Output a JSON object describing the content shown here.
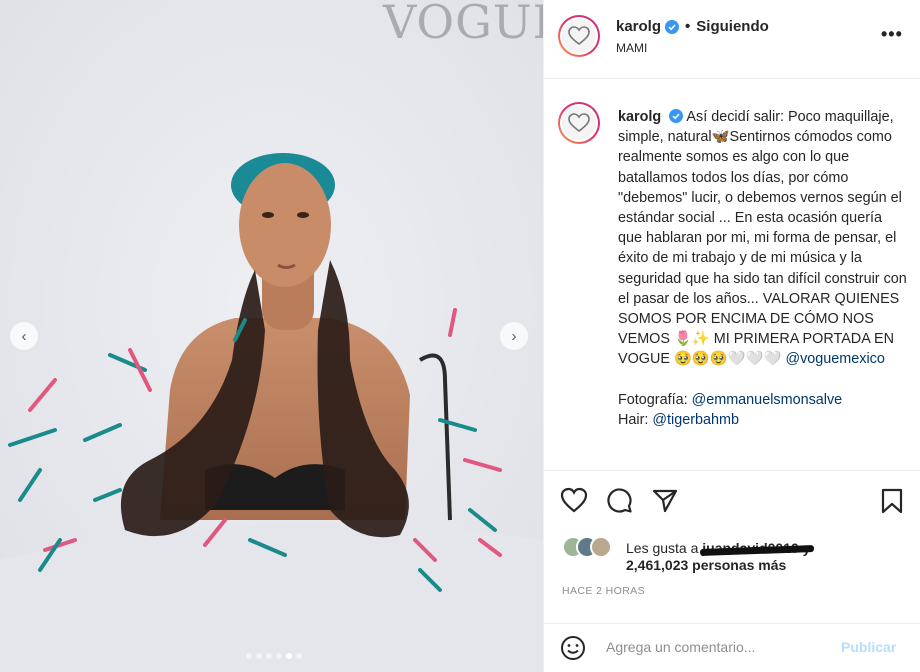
{
  "media": {
    "brand_text": "VOGUE",
    "carousel_dots": 6,
    "carousel_active_index": 4,
    "prev_glyph": "‹",
    "next_glyph": "›"
  },
  "header": {
    "username": "karolg",
    "separator": "•",
    "follow_status": "Siguiendo",
    "location": "MAMI",
    "more_glyph": "•••"
  },
  "caption": {
    "username": "karolg",
    "text_part1": "Así decidí salir: Poco maquillaje, simple, natural🦋Sentirnos cómodos como realmente somos es algo con lo que batallamos todos los días, por cómo \"debemos\" lucir, o debemos vernos según el estándar social ... En esta ocasión quería que hablaran por mi, mi forma de pensar, el éxito de mi trabajo y de mi música y la seguridad que ha sido tan difícil construir con el pasar de los años... VALORAR QUIENES SOMOS POR ENCIMA DE CÓMO NOS VEMOS 🌷✨ MI PRIMERA PORTADA EN VOGUE 🥹🥹🥹🤍🤍🤍",
    "mention_vogue": "@voguemexico",
    "credit_photo_label": "Fotografía: ",
    "credit_photo_mention": "@emmanuelsmonsalve",
    "credit_hair_label": "Hair: ",
    "credit_hair_mention": "@tigerbahmb"
  },
  "actions": {
    "liked_by_prefix": "Les gusta a ",
    "liked_by_user_redacted": "juandavid0010 y",
    "likes_count_text": "2,461,023 personas más",
    "time_ago": "HACE 2 HORAS",
    "comment_placeholder": "Agrega un comentario...",
    "publish_label": "Publicar"
  },
  "colors": {
    "verified": "#3897f0",
    "link": "#00376b",
    "publish_disabled": "#b2dffc"
  }
}
